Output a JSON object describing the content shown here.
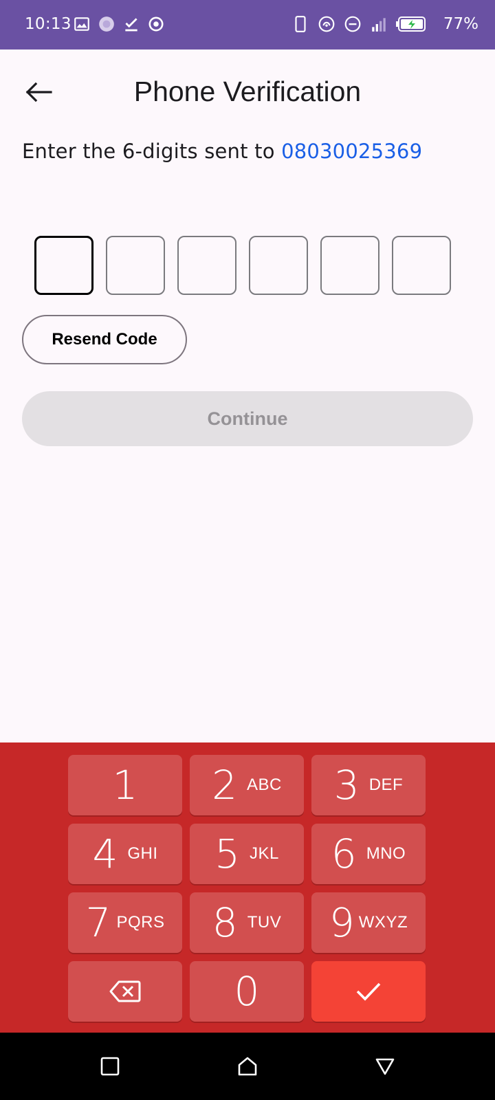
{
  "status_bar": {
    "time": "10:13",
    "battery_percent": "77%",
    "left_icons": [
      "gallery-icon",
      "loading-circle-icon",
      "download-done-icon",
      "target-icon"
    ],
    "right_icons": [
      "phone-outline-icon",
      "hotspot-icon",
      "dnd-icon",
      "signal-icon",
      "battery-charging-icon"
    ],
    "background_color": "#6a51a3"
  },
  "header": {
    "title": "Phone Verification",
    "back_icon": "arrow-left-icon"
  },
  "verification": {
    "prompt": "Enter the 6-digits sent to ",
    "phone_number": "08030025369",
    "phone_color": "#1a5fe6",
    "code_length": 6,
    "code_digits": [
      "",
      "",
      "",
      "",
      "",
      ""
    ]
  },
  "actions": {
    "resend_label": "Resend Code",
    "continue_label": "Continue",
    "continue_enabled": false
  },
  "keypad": {
    "background_color": "#c62828",
    "keys": [
      {
        "digit": "1",
        "letters": ""
      },
      {
        "digit": "2",
        "letters": "ABC"
      },
      {
        "digit": "3",
        "letters": "DEF"
      },
      {
        "digit": "4",
        "letters": "GHI"
      },
      {
        "digit": "5",
        "letters": "JKL"
      },
      {
        "digit": "6",
        "letters": "MNO"
      },
      {
        "digit": "7",
        "letters": "PQRS"
      },
      {
        "digit": "8",
        "letters": "TUV"
      },
      {
        "digit": "9",
        "letters": "WXYZ"
      }
    ],
    "backspace_icon": "backspace-icon",
    "zero": "0",
    "confirm_icon": "checkmark-icon"
  },
  "nav_bar": {
    "buttons": [
      "recents-square-icon",
      "home-icon",
      "back-triangle-icon"
    ]
  }
}
